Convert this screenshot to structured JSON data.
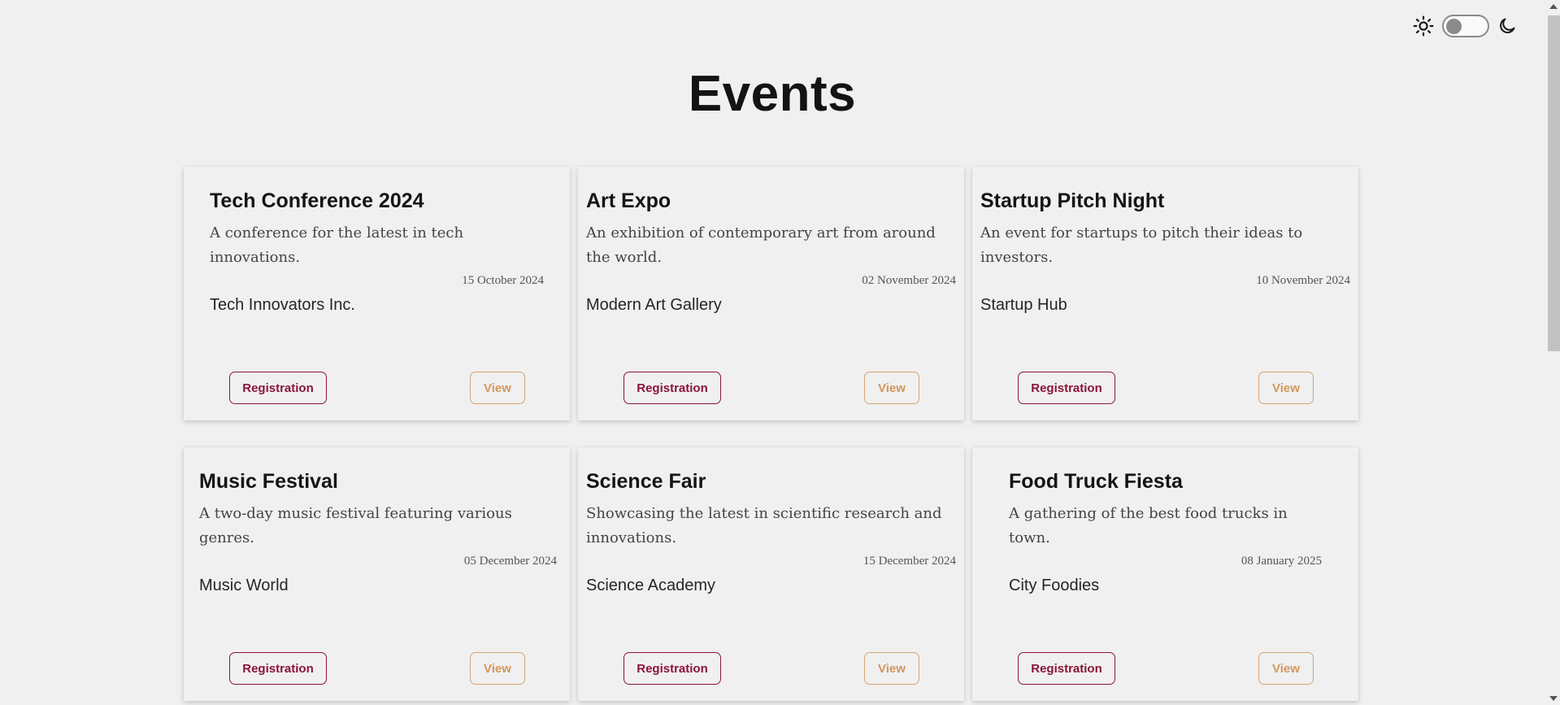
{
  "theme": {
    "mode": "light",
    "sun_icon": "sun-icon",
    "moon_icon": "moon-icon"
  },
  "page": {
    "title": "Events"
  },
  "buttons": {
    "registration": "Registration",
    "view": "View"
  },
  "colors": {
    "registration": "#8b1538",
    "view": "#d3975e",
    "background": "#f0f0f0"
  },
  "events": [
    {
      "title": "Tech Conference 2024",
      "description": "A conference for the latest in tech innovations.",
      "date": "15 October 2024",
      "organizer": "Tech Innovators Inc."
    },
    {
      "title": "Art Expo",
      "description": "An exhibition of contemporary art from around the world.",
      "date": "02 November 2024",
      "organizer": "Modern Art Gallery"
    },
    {
      "title": "Startup Pitch Night",
      "description": "An event for startups to pitch their ideas to investors.",
      "date": "10 November 2024",
      "organizer": "Startup Hub"
    },
    {
      "title": "Music Festival",
      "description": "A two-day music festival featuring various genres.",
      "date": "05 December 2024",
      "organizer": "Music World"
    },
    {
      "title": "Science Fair",
      "description": "Showcasing the latest in scientific research and innovations.",
      "date": "15 December 2024",
      "organizer": "Science Academy"
    },
    {
      "title": "Food Truck Fiesta",
      "description": "A gathering of the best food trucks in town.",
      "date": "08 January 2025",
      "organizer": "City Foodies"
    }
  ]
}
